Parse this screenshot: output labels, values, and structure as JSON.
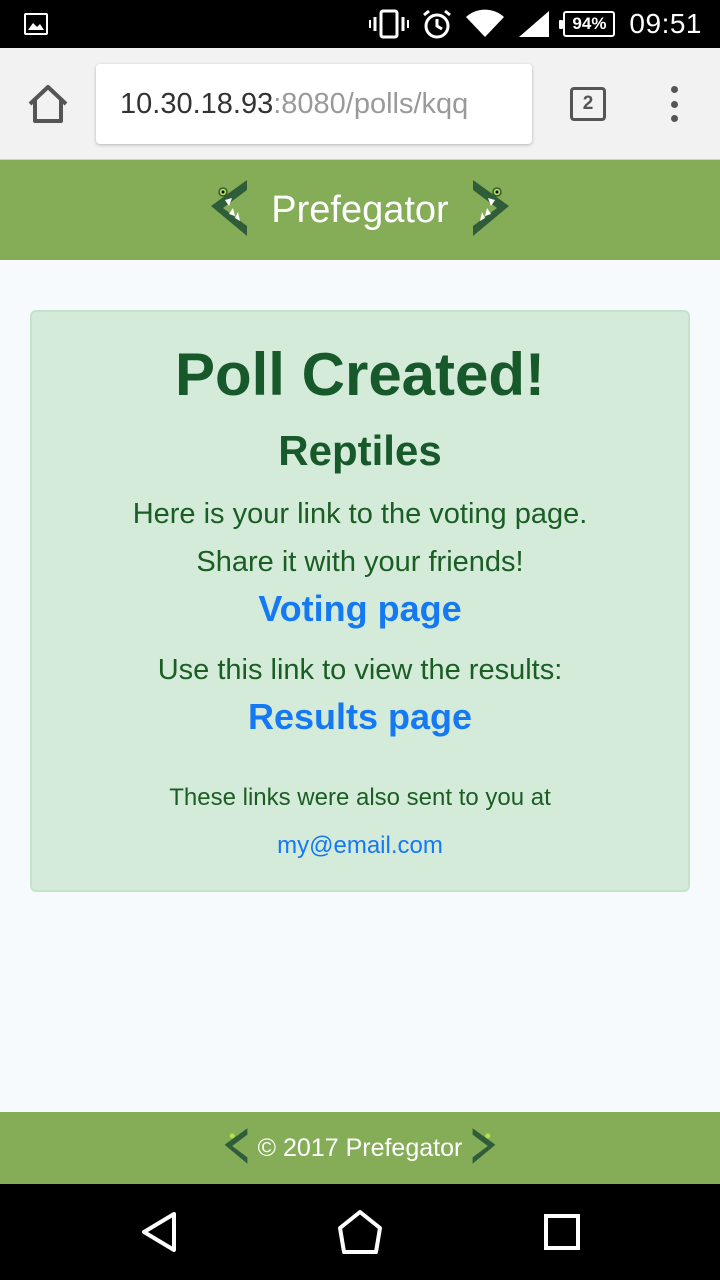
{
  "status_bar": {
    "battery": "94%",
    "time": "09:51",
    "icons": [
      "gallery-icon",
      "vibrate-icon",
      "alarm-icon",
      "wifi-icon",
      "signal-icon",
      "battery-icon"
    ]
  },
  "browser": {
    "url_host": "10.30.18.93",
    "url_rest": ":8080/polls/kqq",
    "tab_count": "2"
  },
  "header": {
    "title": "Prefegator"
  },
  "card": {
    "title": "Poll Created!",
    "poll_name": "Reptiles",
    "line1": "Here is your link to the voting page.",
    "line2": "Share it with your friends!",
    "voting_link": "Voting page",
    "results_intro": "Use this link to view the results:",
    "results_link": "Results page",
    "email_note": "These links were also sent to you at",
    "email": "my@email.com"
  },
  "footer": {
    "text": "© 2017 Prefegator"
  },
  "colors": {
    "header_bg": "#85ad57",
    "card_bg": "#d4ebda",
    "card_text": "#17592a",
    "link": "#1479f2"
  }
}
